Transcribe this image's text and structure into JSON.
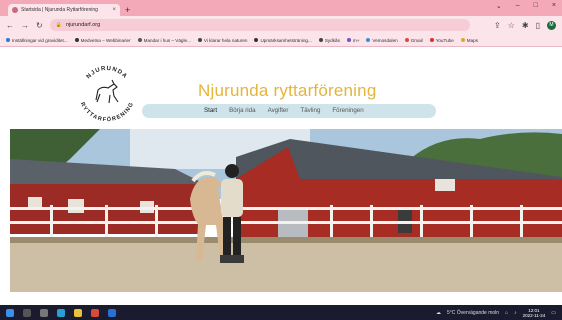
{
  "browser": {
    "tab_title": "Startsida | Njurunda Ryttarförening",
    "tab_close": "×",
    "new_tab": "+",
    "url": "njurundarf.org",
    "window_controls": [
      "⌄",
      "–",
      "□",
      "×"
    ],
    "profile_initial": "M",
    "bookmarks": [
      {
        "label": "Inställningar vid graviditet...",
        "color": "#2a7bd4"
      },
      {
        "label": "Medvetna – Webbinarier",
        "color": "#333333"
      },
      {
        "label": "Mandar i hus – Vägle...",
        "color": "#555555"
      },
      {
        "label": "Vi klarar hela naturen",
        "color": "#444444"
      },
      {
        "label": "Upmärksamhetsträning...",
        "color": "#333333"
      },
      {
        "label": "Sydkås",
        "color": "#444444"
      },
      {
        "label": "m+",
        "color": "#7a4fc2"
      },
      {
        "label": "Vemosdalen",
        "color": "#3c8bd8"
      },
      {
        "label": "Gmail",
        "color": "#d64b3c"
      },
      {
        "label": "YouTube",
        "color": "#e02b2b"
      },
      {
        "label": "Maps",
        "color": "#e0a52b"
      }
    ]
  },
  "site": {
    "title": "Njurunda ryttarförening",
    "logo_top_text": "NJURUNDA",
    "logo_bottom_text": "RYTTARFÖRENING",
    "nav": [
      "Start",
      "Börja rida",
      "Avgifter",
      "Tävling",
      "Föreningen"
    ]
  },
  "colors": {
    "title": "#e3b53a",
    "nav_bar": "#cfe3ea",
    "browser_tabs": "#f3a9b8",
    "taskbar": "#1b1b2f"
  },
  "taskbar": {
    "weather": "5°C Övervägande moln",
    "time": "12:01",
    "date": "2022-11-24"
  }
}
